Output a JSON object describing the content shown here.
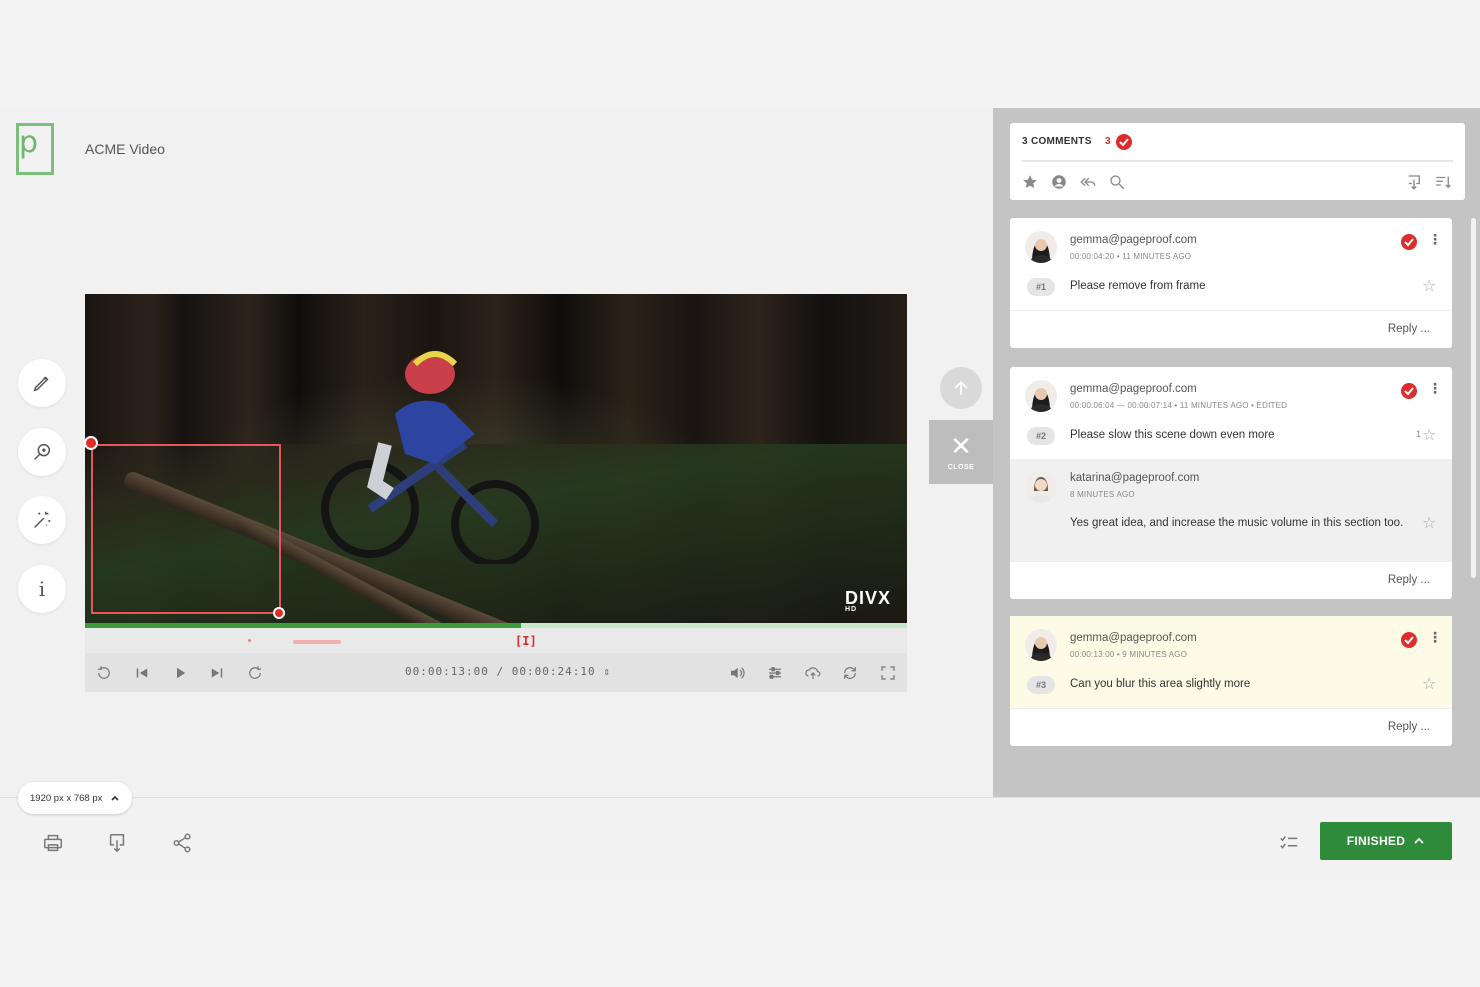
{
  "project": {
    "title": "ACME Video",
    "logo_letter": "p"
  },
  "player": {
    "current_time": "00:00:13:00",
    "duration": "/ 00:00:24:10",
    "progress": 0.53,
    "marker": "[I]",
    "watermark": "DIVX",
    "watermark_sub": "HD"
  },
  "close_tab": {
    "label": "CLOSE"
  },
  "panel": {
    "header_label": "3 COMMENTS",
    "resolved_count": "3",
    "reply_label": "Reply ..."
  },
  "comments": [
    {
      "pin": "#1",
      "author": "gemma@pageproof.com",
      "meta": "00:00:04:20  •  11 MINUTES AGO",
      "text": "Please remove from frame"
    },
    {
      "pin": "#2",
      "author": "gemma@pageproof.com",
      "meta": "00:00:06:04 — 00:00:07:14  •  11 MINUTES AGO  •  EDITED",
      "text": "Please slow this scene down even more",
      "stars": "1",
      "reply": {
        "author": "katarina@pageproof.com",
        "meta": "8 MINUTES AGO",
        "text": "Yes great idea, and increase the music volume in this section too."
      }
    },
    {
      "pin": "#3",
      "author": "gemma@pageproof.com",
      "meta": "00:00:13:00  •  9 MINUTES AGO",
      "text": "Can you blur this area slightly more"
    }
  ],
  "footer": {
    "resolution": "1920 px x 768 px",
    "finished_label": "FINISHED"
  },
  "colors": {
    "accent_green": "#2e8b3a",
    "resolved_red": "#e02b2b",
    "highlight": "#fdfbe6"
  }
}
